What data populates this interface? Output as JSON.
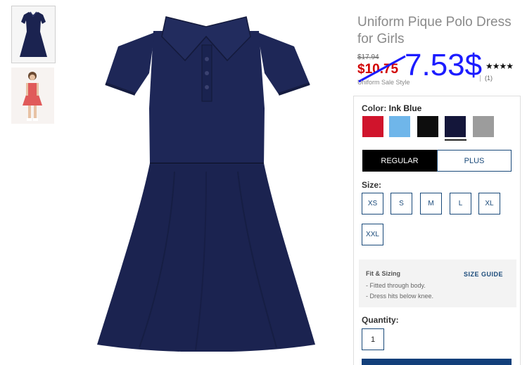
{
  "product": {
    "title": "Uniform Pique Polo Dress for Girls",
    "old_price": "$17.94",
    "sale_price": "$10.75",
    "overlay_price": "7.53$",
    "sale_style": "Uniform Sale Style",
    "stars": "★★★★",
    "review_count": "(1)"
  },
  "colors": {
    "label": "Color:",
    "selected": "Ink Blue",
    "swatches": [
      {
        "name": "red",
        "hex": "#d0142c"
      },
      {
        "name": "light-blue",
        "hex": "#6fb6ea"
      },
      {
        "name": "black",
        "hex": "#0d0d0d"
      },
      {
        "name": "ink-blue",
        "hex": "#14163a"
      },
      {
        "name": "heather-gray",
        "hex": "#9c9c9c"
      }
    ]
  },
  "fit": {
    "regular": "REGULAR",
    "plus": "PLUS"
  },
  "sizes": {
    "label": "Size:",
    "options": [
      "XS",
      "S",
      "M",
      "L",
      "XL",
      "XXL"
    ]
  },
  "fit_sizing": {
    "title": "Fit & Sizing",
    "guide": "SIZE GUIDE",
    "notes": [
      "- Fitted through body.",
      "- Dress hits below knee."
    ]
  },
  "quantity": {
    "label": "Quantity:",
    "value": "1"
  },
  "theme": {
    "accent": "#1a4a7a",
    "sale_red": "#d10000",
    "dress": "#1b2350"
  }
}
